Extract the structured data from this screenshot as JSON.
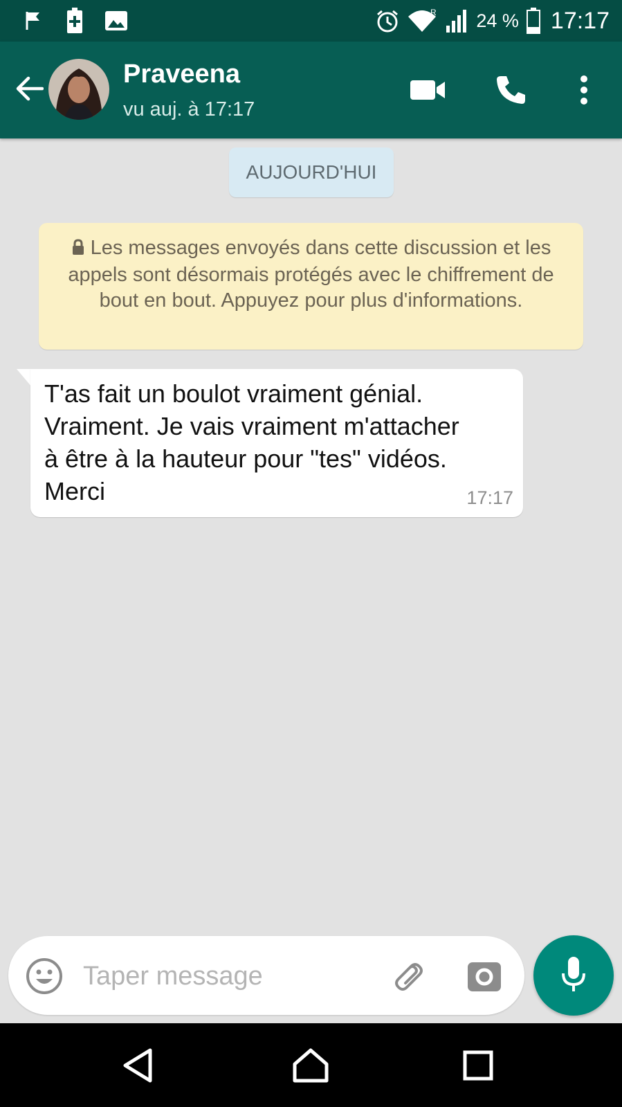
{
  "status_bar": {
    "battery_percent": "24 %",
    "time": "17:17",
    "left_icons": [
      "flag-icon",
      "battery-saver-icon",
      "image-icon"
    ],
    "right_icons": [
      "alarm-icon",
      "wifi-icon",
      "signal-icon",
      "battery-icon"
    ],
    "roaming_label": "R"
  },
  "header": {
    "contact_name": "Praveena",
    "last_seen": "vu auj. à 17:17",
    "actions": [
      "video-call-icon",
      "phone-icon",
      "more-icon"
    ]
  },
  "chat": {
    "date_chip": "AUJOURD'HUI",
    "encryption_notice": "Les messages envoyés dans cette discussion et les appels sont désormais protégés avec le chiffrement de bout en bout. Appuyez pour plus d'informations.",
    "messages": [
      {
        "text": "T'as fait un boulot vraiment génial.\nVraiment. Je vais vraiment m'attacher\nà être à la hauteur pour \"tes\" vidéos.\nMerci",
        "time": "17:17",
        "direction": "incoming"
      }
    ]
  },
  "composer": {
    "placeholder": "Taper message",
    "value": ""
  },
  "colors": {
    "status_bar": "#054d44",
    "app_bar": "#075e54",
    "chat_background": "#e2e2e2",
    "mic_button": "#00897b",
    "encryption_notice_bg": "#fbf1c6",
    "date_chip_bg": "#d8eaf3"
  }
}
